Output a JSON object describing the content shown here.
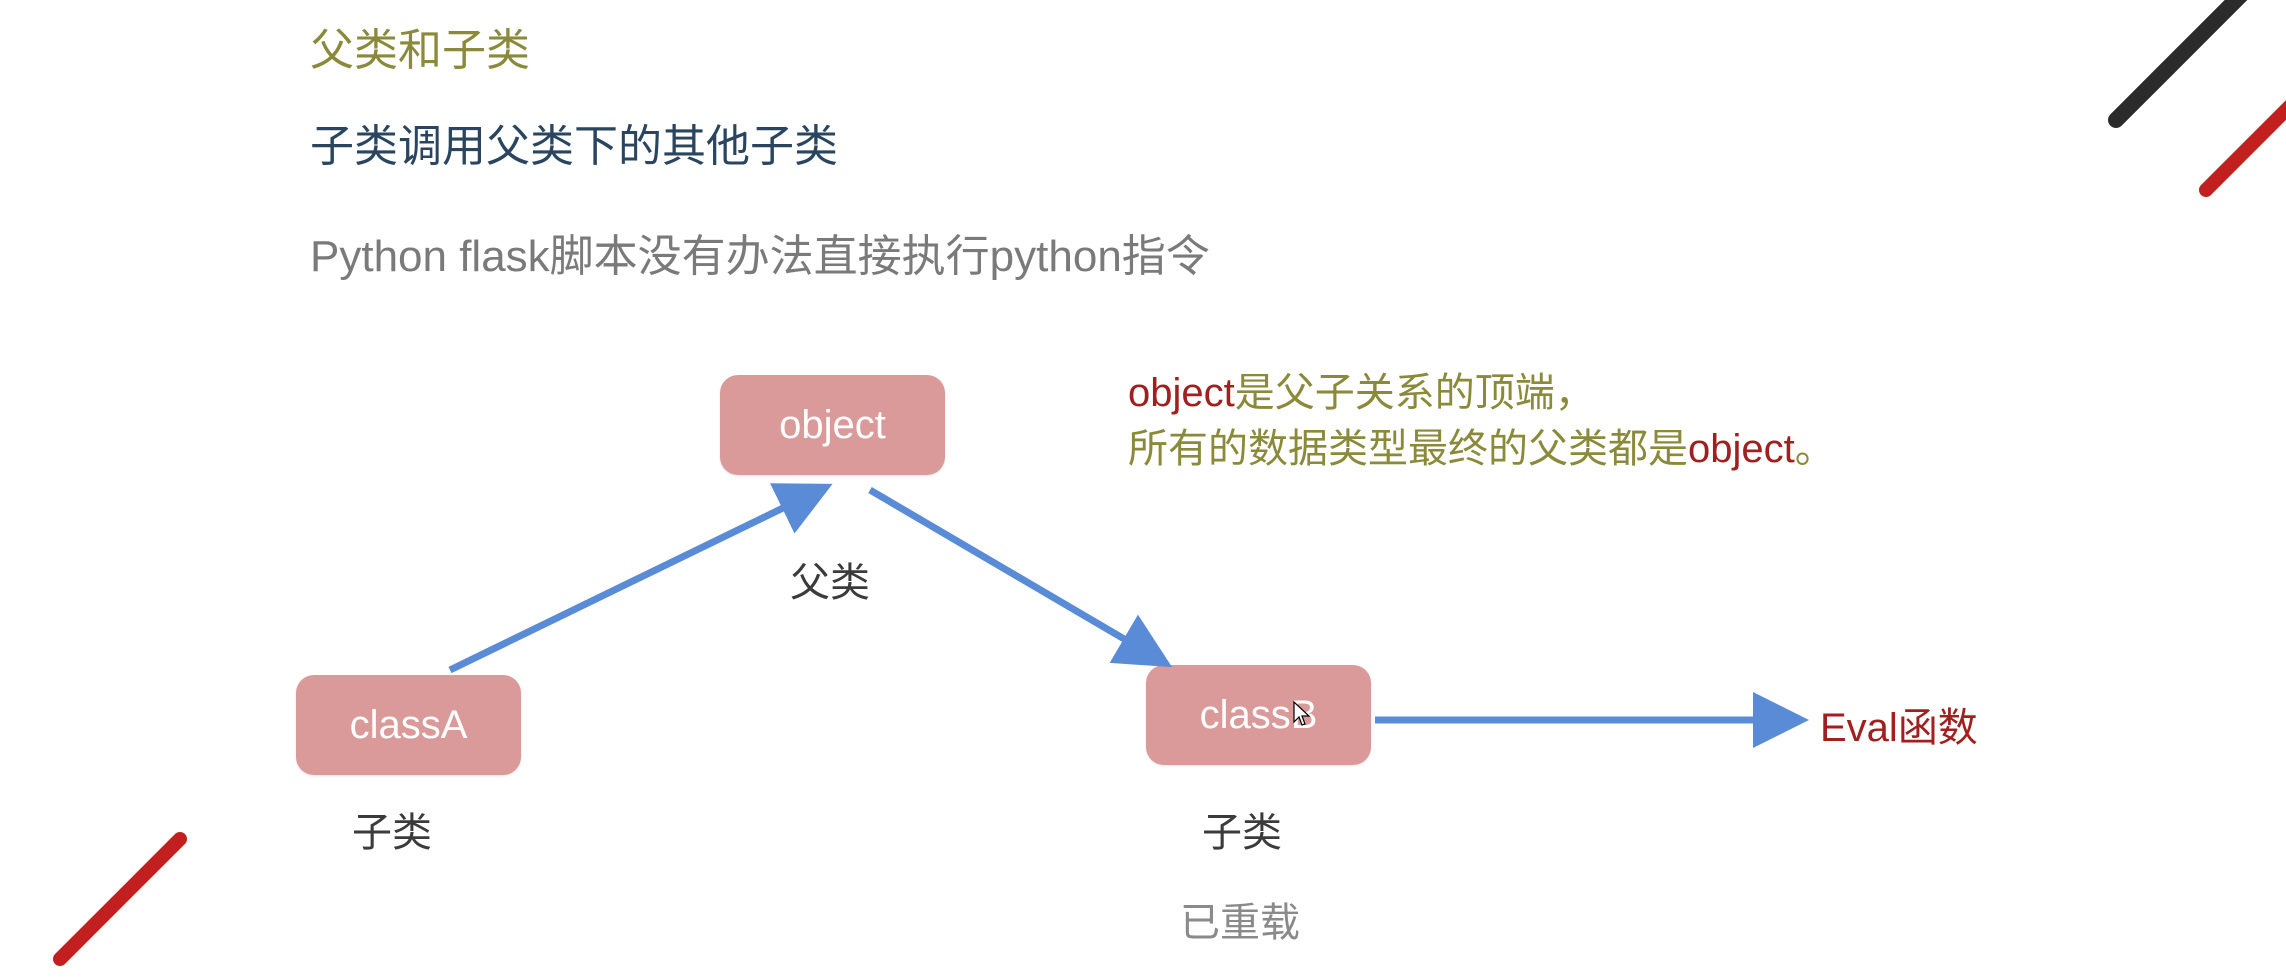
{
  "headings": {
    "title1": "父类和子类",
    "title2": "子类调用父类下的其他子类",
    "title3": "Python flask脚本没有办法直接执行python指令"
  },
  "diagram": {
    "nodes": {
      "object": "object",
      "classA": "classA",
      "classB": "classB"
    },
    "labels": {
      "parent": "父类",
      "childA": "子类",
      "childB": "子类",
      "overloaded": "已重载"
    },
    "arrows": {
      "classA_to_object": {
        "from": "classA",
        "to": "object"
      },
      "object_to_classB": {
        "from": "object",
        "to": "classB"
      },
      "classB_to_eval": {
        "from": "classB",
        "to": "eval"
      }
    },
    "eval_label": "Eval函数"
  },
  "description": {
    "line1_red": "object",
    "line1_rest": "是父子关系的顶端，",
    "line2_pre": "所有的数据类型最终的父类都是",
    "line2_red": "object",
    "line2_post": "。"
  },
  "colors": {
    "node_bg": "#db9a9a",
    "node_fg": "#ffffff",
    "arrow": "#5a8bd6",
    "olive": "#8a8a3a",
    "darkblue": "#2a4560",
    "gray": "#7a7a7a",
    "red": "#a02020",
    "corner_black": "#2b2b2b",
    "corner_red": "#c21f1f"
  }
}
